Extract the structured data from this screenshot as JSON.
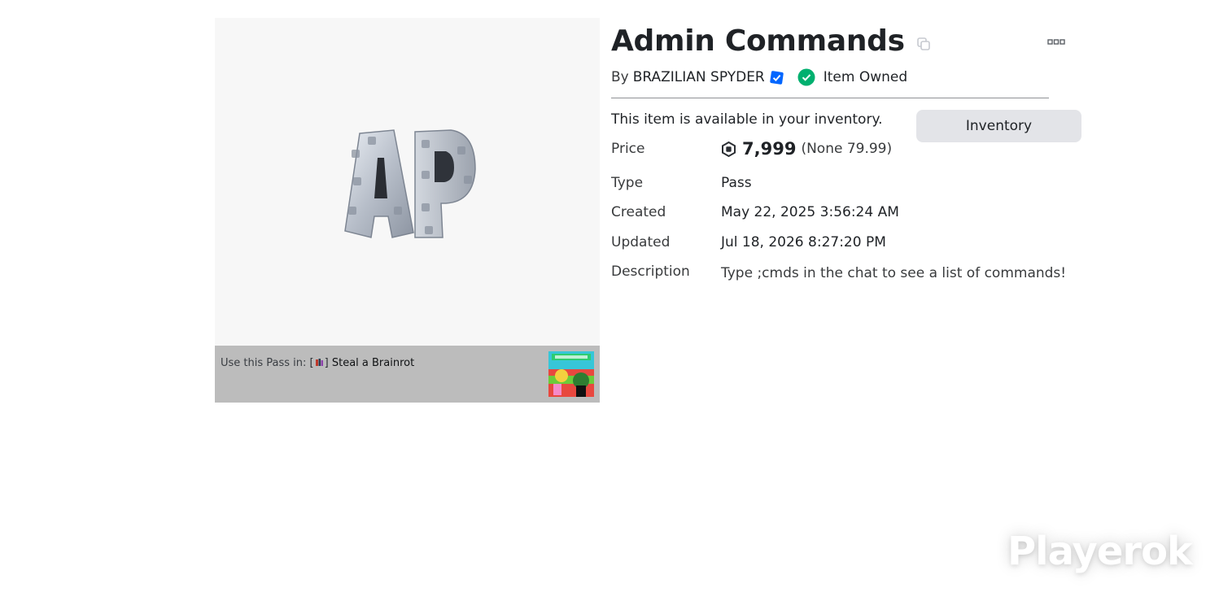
{
  "item": {
    "title": "Admin Commands",
    "by_label": "By",
    "creator": "BRAZILIAN SPYDER",
    "owned_label": "Item Owned",
    "availability_text": "This item is available in your inventory.",
    "inventory_button": "Inventory"
  },
  "thumbnail": {
    "icon": "ap-letters-logo",
    "use_prefix": "Use this Pass in:",
    "game_open": "[",
    "game_close": "]",
    "game_name": "Steal a Brainrot",
    "game_icon": "game-thumbnail"
  },
  "details": {
    "price_label": "Price",
    "price_amount": "7,999",
    "price_alt": "(None 79.99)",
    "type_label": "Type",
    "type_value": "Pass",
    "created_label": "Created",
    "created_value": "May 22, 2025 3:56:24 AM",
    "updated_label": "Updated",
    "updated_value": "Jul 18, 2026 8:27:20 PM",
    "description_label": "Description",
    "description_value": "Type ;cmds in the chat to see a list of commands!"
  },
  "watermark": "Playerok",
  "colors": {
    "verified_blue": "#0066ff",
    "owned_green": "#00b06f",
    "button_bg": "#e3e4e8",
    "use_bar_bg": "#bcbcbc"
  }
}
